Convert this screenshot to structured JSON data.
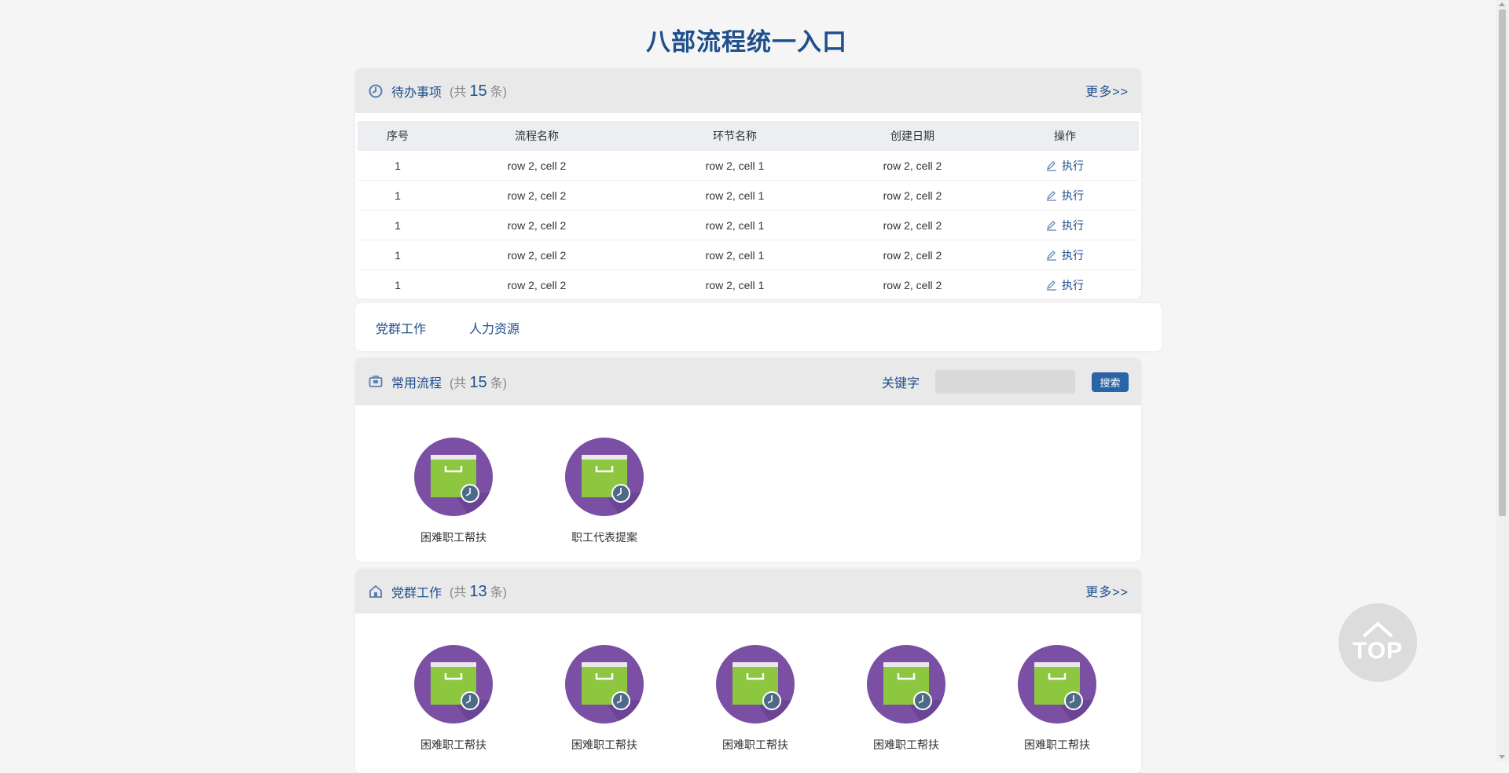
{
  "title": "八部流程统一入口",
  "todo": {
    "icon": "clock-icon",
    "title": "待办事项",
    "count_prefix": "(共",
    "count": "15",
    "count_suffix": "条)",
    "more": "更多>>",
    "columns": [
      "序号",
      "流程名称",
      "环节名称",
      "创建日期",
      "操作"
    ],
    "rows": [
      {
        "no": "1",
        "process": "row 2, cell 2",
        "step": "row 2, cell 1",
        "date": "row 2, cell 2",
        "action": "执行"
      },
      {
        "no": "1",
        "process": "row 2, cell 2",
        "step": "row 2, cell 1",
        "date": "row 2, cell 2",
        "action": "执行"
      },
      {
        "no": "1",
        "process": "row 2, cell 2",
        "step": "row 2, cell 1",
        "date": "row 2, cell 2",
        "action": "执行"
      },
      {
        "no": "1",
        "process": "row 2, cell 2",
        "step": "row 2, cell 1",
        "date": "row 2, cell 2",
        "action": "执行"
      },
      {
        "no": "1",
        "process": "row 2, cell 2",
        "step": "row 2, cell 1",
        "date": "row 2, cell 2",
        "action": "执行"
      }
    ]
  },
  "tabs": [
    "党群工作",
    "人力资源"
  ],
  "common": {
    "icon": "briefcase-icon",
    "title": "常用流程",
    "count_prefix": "(共",
    "count": "15",
    "count_suffix": "条)",
    "keyword_label": "关键字",
    "search_value": "",
    "search_button": "搜索",
    "apps": [
      "困难职工帮扶",
      "职工代表提案"
    ]
  },
  "party": {
    "icon": "home-icon",
    "title": "党群工作",
    "count_prefix": "(共",
    "count": "13",
    "count_suffix": "条)",
    "more": "更多>>",
    "apps": [
      "困难职工帮扶",
      "困难职工帮扶",
      "困难职工帮扶",
      "困难职工帮扶",
      "困难职工帮扶"
    ]
  },
  "top_button": "TOP",
  "colors": {
    "accent": "#1f4f8c",
    "app_bg": "#7b4fa3",
    "bag": "#8dc63f",
    "button": "#2b63a8"
  }
}
